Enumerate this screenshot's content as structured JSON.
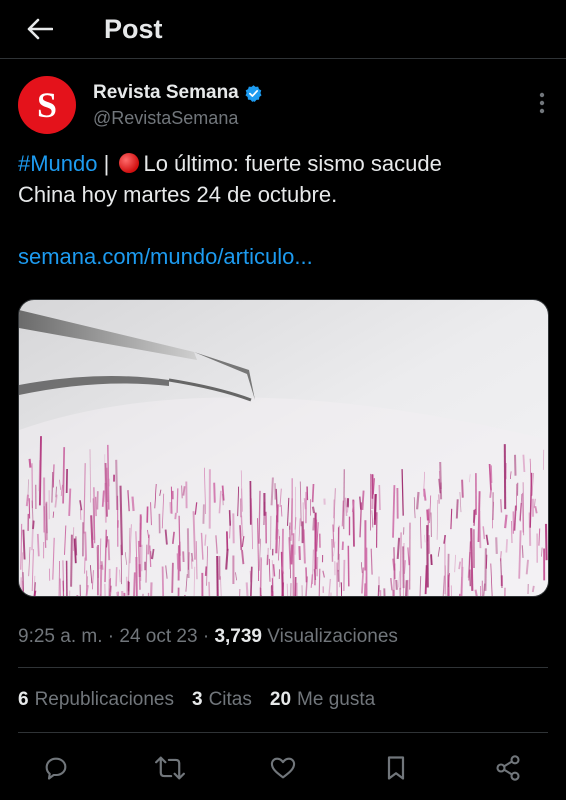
{
  "header": {
    "title": "Post",
    "back_icon": "arrow-left-icon"
  },
  "author": {
    "avatar_letter": "S",
    "avatar_color": "#e4121b",
    "name": "Revista Semana",
    "handle": "@RevistaSemana",
    "verified_icon": "verified-badge-icon",
    "verified_color": "#1d9bf0"
  },
  "post": {
    "hashtag": "#Mundo",
    "separator": " | ",
    "text_part1": "Lo último: fuerte sismo sacude",
    "text_part2": "China hoy martes 24 de octubre.",
    "link": "semana.com/mundo/articulo...",
    "media_description_icon": "seismograph-image"
  },
  "meta": {
    "time": "9:25 a. m.",
    "date": "24 oct 23",
    "views_count": "3,739",
    "views_label": "Visualizaciones"
  },
  "stats": {
    "reposts_count": "6",
    "reposts_label": "Republicaciones",
    "quotes_count": "3",
    "quotes_label": "Citas",
    "likes_count": "20",
    "likes_label": "Me gusta"
  },
  "colors": {
    "background": "#000000",
    "text": "#e7e9ea",
    "muted": "#71767b",
    "accent": "#1d9bf0",
    "divider": "#2f3336"
  }
}
